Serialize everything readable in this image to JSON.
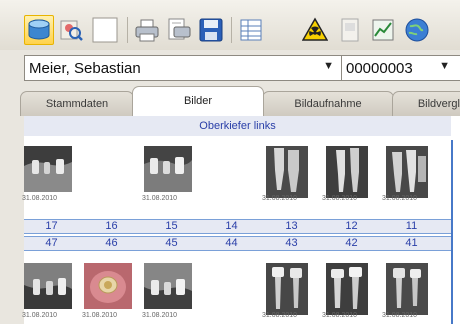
{
  "toolbar": {
    "icons": [
      "database-icon",
      "search-person-icon",
      "blank-document-icon",
      "printer-icon",
      "print-preview-icon",
      "save-icon",
      "table-icon",
      "radiation-icon",
      "document-icon",
      "chart-icon",
      "globe-icon"
    ]
  },
  "patient": {
    "name": "Meier, Sebastian",
    "id": "00000003"
  },
  "tabs": [
    "Stammdaten",
    "Bilder",
    "Bildaufnahme",
    "Bildvergleich"
  ],
  "active_tab": "Bilder",
  "section": {
    "title": "Oberkiefer links"
  },
  "upper_row": {
    "cells": [
      {
        "date": "31.08.2010"
      },
      {
        "date": ""
      },
      {
        "date": "31.08.2010"
      },
      {
        "date": ""
      },
      {
        "date": "31.08.2010"
      },
      {
        "date": "31.08.2010"
      },
      {
        "date": "31.08.2010"
      }
    ]
  },
  "tooth_numbers": {
    "upper": [
      "17",
      "16",
      "15",
      "14",
      "13",
      "12",
      "11"
    ],
    "lower": [
      "47",
      "46",
      "45",
      "44",
      "43",
      "42",
      "41"
    ]
  },
  "lower_row": {
    "cells": [
      {
        "date": "31.08.2010"
      },
      {
        "date": "31.08.2010"
      },
      {
        "date": "31.08.2010"
      },
      {
        "date": ""
      },
      {
        "date": "31.08.2010"
      },
      {
        "date": "31.08.2010"
      },
      {
        "date": "31.08.2010"
      }
    ]
  },
  "colors": {
    "accent": "#2a3fa8",
    "grid_line": "#4779c8",
    "header_bg": "#e6e9f3",
    "selected_tool": "#ffd24a"
  }
}
